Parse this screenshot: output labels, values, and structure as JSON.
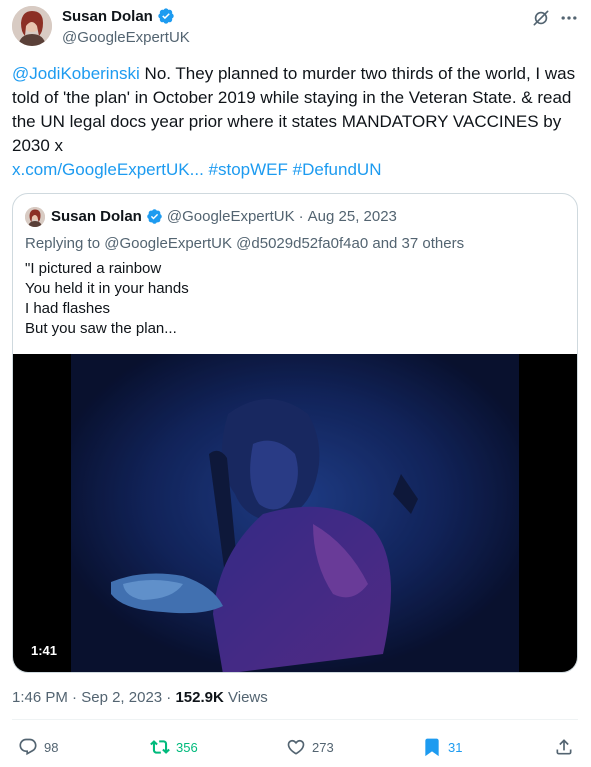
{
  "colors": {
    "accent": "#1d9bf0",
    "retweeted": "#00ba7c",
    "text_primary": "#0f1419",
    "text_secondary": "#536471",
    "border": "#cfd9de"
  },
  "tweet": {
    "author": {
      "display_name": "Susan Dolan",
      "handle": "@GoogleExpertUK",
      "verified_icon": "verified-badge-icon"
    },
    "text": {
      "mention": "@JodiKoberinski",
      "body": " No. They planned to murder two thirds of the world, I was told of 'the plan' in October 2019 while staying in the Veteran State. & read the UN legal docs year prior where it states MANDATORY VACCINES by 2030 x",
      "url": "x.com/GoogleExpertUK...",
      "hashtag_1": "#stopWEF",
      "hashtag_2": "#DefundUN"
    },
    "quoted": {
      "display_name": "Susan Dolan",
      "handle": "@GoogleExpertUK",
      "separator": "·",
      "date": "Aug 25, 2023",
      "replying_to_prefix": "Replying to ",
      "replying_to_users": "@GoogleExpertUK @d5029d52fa0f4a0",
      "replying_to_suffix": " and 37 others",
      "lines": [
        "\"I pictured a rainbow",
        "You held it in your hands",
        "I had flashes",
        "But you saw the plan..."
      ],
      "video_duration": "1:41"
    },
    "meta": {
      "time": "1:46 PM",
      "separator": "·",
      "date": "Sep 2, 2023",
      "separator2": "·",
      "views_count": "152.9K",
      "views_label": "Views"
    },
    "actions": {
      "replies": "98",
      "retweets": "356",
      "likes": "273",
      "bookmarks": "31"
    },
    "icons": {
      "grok": "grok-icon",
      "more": "more-icon",
      "reply": "reply-icon",
      "retweet": "retweet-icon",
      "like": "heart-icon",
      "bookmark": "bookmark-icon",
      "share": "share-icon"
    }
  }
}
